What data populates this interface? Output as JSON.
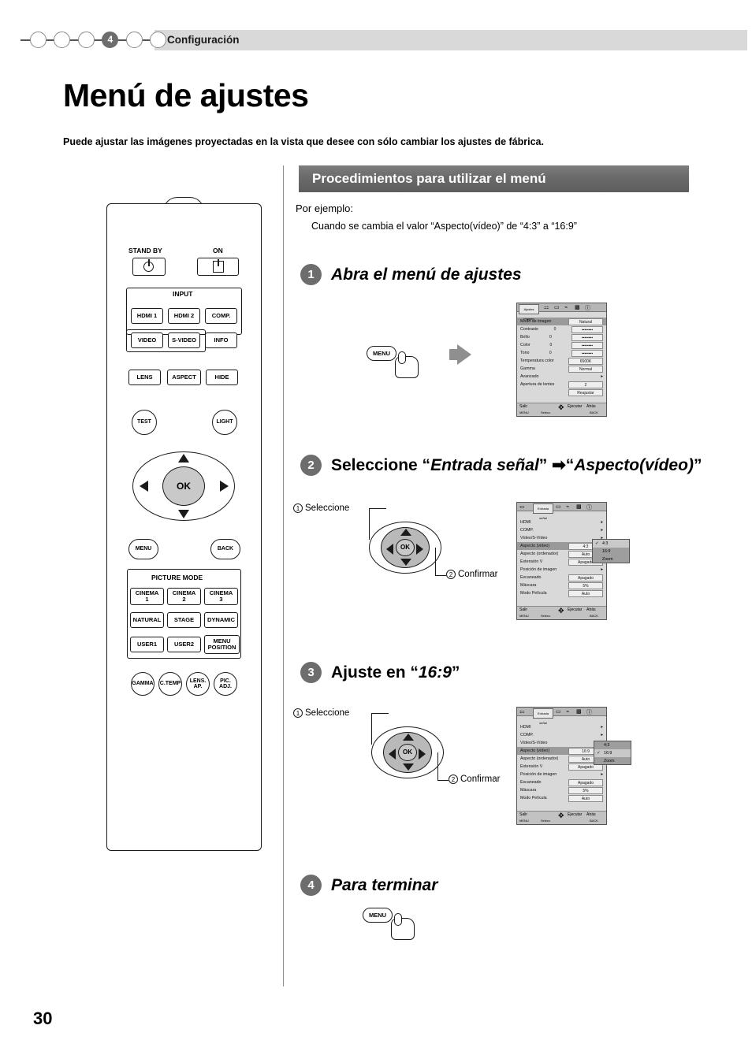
{
  "header": {
    "chapter_number": "4",
    "chapter_title": "Configuración",
    "dots_total": 6,
    "active_dot_index": 2
  },
  "page": {
    "title": "Menú de ajustes",
    "intro": "Puede ajustar las imágenes proyectadas en la vista que desee con sólo cambiar los ajustes de fábrica.",
    "page_number": "30"
  },
  "section": {
    "banner": "Procedimientos para utilizar el menú",
    "example_label": "Por ejemplo:",
    "example_text": "Cuando se cambia el valor “Aspecto(vídeo)” de “4:3” a “16:9”"
  },
  "steps": [
    {
      "num": "1",
      "text": "Abra el menú de ajustes"
    },
    {
      "num": "2",
      "text_a": "Seleccione “",
      "text_b": "Entrada señal",
      "text_c": "” ",
      "arrow": "➡",
      "text_d": "“",
      "text_e": "Aspecto(vídeo)",
      "text_f": "”"
    },
    {
      "num": "3",
      "text_a": "Ajuste en “",
      "text_b": "16:9",
      "text_c": "”"
    },
    {
      "num": "4",
      "text": "Para terminar"
    }
  ],
  "callouts": {
    "seleccione": "Seleccione",
    "confirmar": "Confirmar",
    "num1": "1",
    "num2": "2",
    "menu_chip": "MENU",
    "ok": "OK"
  },
  "remote": {
    "standby_label": "STAND BY",
    "on_label": "ON",
    "input_label": "INPUT",
    "input_buttons": [
      "HDMI 1",
      "HDMI 2",
      "COMP.",
      "VIDEO",
      "S-VIDEO",
      "INFO"
    ],
    "row_lens": [
      "LENS",
      "ASPECT",
      "HIDE"
    ],
    "test_label": "TEST",
    "light_label": "LIGHT",
    "ok_label": "OK",
    "menu_label": "MENU",
    "back_label": "BACK",
    "picture_mode_title": "PICTURE MODE",
    "picture_mode_buttons": [
      {
        "l1": "CINEMA",
        "l2": "1"
      },
      {
        "l1": "CINEMA",
        "l2": "2"
      },
      {
        "l1": "CINEMA",
        "l2": "3"
      },
      {
        "l1": "NATURAL",
        "l2": ""
      },
      {
        "l1": "STAGE",
        "l2": ""
      },
      {
        "l1": "DYNAMIC",
        "l2": ""
      },
      {
        "l1": "USER1",
        "l2": ""
      },
      {
        "l1": "USER2",
        "l2": ""
      },
      {
        "l1": "MENU",
        "l2": "POSITION"
      }
    ],
    "bottom_round_buttons": [
      {
        "l1": "GAMMA",
        "l2": ""
      },
      {
        "l1": "C.TEMP",
        "l2": ""
      },
      {
        "l1": "LENS.",
        "l2": "AP."
      },
      {
        "l1": "PIC.",
        "l2": "ADJ."
      }
    ]
  },
  "osd1": {
    "tab_label": "Ajustes Imagen",
    "header_row": {
      "label": "Modo de imagen",
      "value": "Natural"
    },
    "rows": [
      {
        "label": "Contraste",
        "value": "0",
        "slider": true
      },
      {
        "label": "Brillo",
        "value": "0",
        "slider": true
      },
      {
        "label": "Color",
        "value": "0",
        "slider": true
      },
      {
        "label": "Tono",
        "value": "0",
        "slider": true
      },
      {
        "label": "Temperatura color",
        "value": "6500K"
      },
      {
        "label": "Gamma",
        "value": "Normal"
      },
      {
        "label": "Avanzado",
        "value": ""
      },
      {
        "label": "Apertura de lentes",
        "value": "2"
      },
      {
        "label": "",
        "value": "Reajustar"
      }
    ],
    "footer": {
      "exit": "Salir",
      "exit_key": "MENU",
      "select": "Selecc.",
      "execute": "Ejecutar",
      "back": "Atrás",
      "back_key": "BACK"
    }
  },
  "osd2": {
    "tab_label": "Entrada señal",
    "rows": [
      {
        "label": "HDMI",
        "value": "",
        "arrow": true
      },
      {
        "label": "COMP.",
        "value": "",
        "arrow": true
      },
      {
        "label": "Vídeo/S-Vídeo",
        "value": "",
        "arrow": true
      },
      {
        "label": "Aspecto (vídeo)",
        "value": "4:3",
        "selected": true
      },
      {
        "label": "Aspecto (ordenador)",
        "value": "Auto"
      },
      {
        "label": "Extensión V",
        "value": "Apagado"
      },
      {
        "label": "Posición de imagen",
        "value": "",
        "arrow": true
      },
      {
        "label": "Escaneado",
        "value": "Apagado"
      },
      {
        "label": "Máscara",
        "value": "5%"
      },
      {
        "label": "Modo Película",
        "value": "Auto"
      }
    ],
    "popup": {
      "options": [
        "4:3",
        "16:9",
        "Zoom"
      ],
      "checked": "4:3"
    },
    "footer": {
      "exit": "Salir",
      "exit_key": "MENU",
      "select": "Selecc.",
      "execute": "Ejecutar",
      "back": "Atrás",
      "back_key": "BACK"
    }
  },
  "osd3": {
    "tab_label": "Entrada señal",
    "rows": [
      {
        "label": "HDMI",
        "value": "",
        "arrow": true
      },
      {
        "label": "COMP.",
        "value": "",
        "arrow": true
      },
      {
        "label": "Vídeo/S-Vídeo",
        "value": "",
        "arrow": true
      },
      {
        "label": "Aspecto (vídeo)",
        "value": "16:9",
        "selected": true
      },
      {
        "label": "Aspecto (ordenador)",
        "value": "Auto"
      },
      {
        "label": "Extensión V",
        "value": "Apagado"
      },
      {
        "label": "Posición de imagen",
        "value": "",
        "arrow": true
      },
      {
        "label": "Escaneado",
        "value": "Apagado"
      },
      {
        "label": "Máscara",
        "value": "5%"
      },
      {
        "label": "Modo Película",
        "value": "Auto"
      }
    ],
    "popup": {
      "options": [
        "4:3",
        "16:9",
        "Zoom"
      ],
      "checked": "16:9"
    },
    "footer": {
      "exit": "Salir",
      "exit_key": "MENU",
      "select": "Selecc.",
      "execute": "Ejecutar",
      "back": "Atrás",
      "back_key": "BACK"
    }
  },
  "colors": {
    "banner_gray": "#6a6a6a",
    "header_gray": "#d9d9d9",
    "osd_bg": "#d9d9d9",
    "osd_select": "#9a9a9a"
  }
}
